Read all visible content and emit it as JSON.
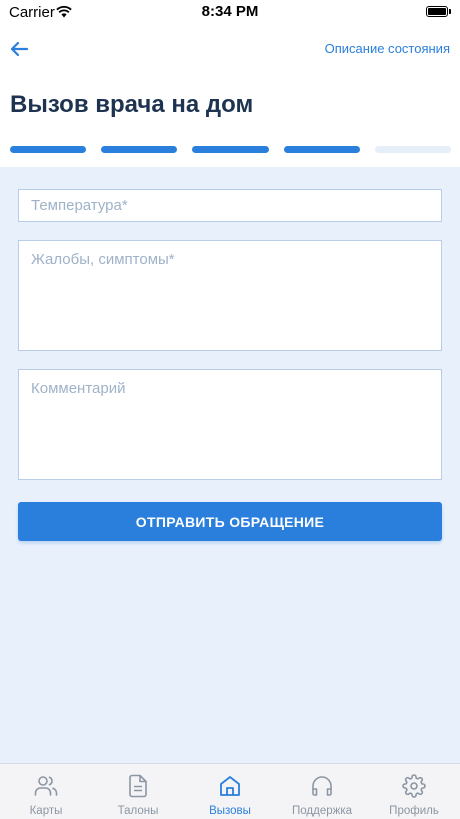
{
  "status_bar": {
    "carrier": "Carrier",
    "time": "8:34 PM"
  },
  "header": {
    "state_description_link": "Описание состояния",
    "title": "Вызов врача на дом",
    "steps": {
      "completed": 4,
      "total": 5
    }
  },
  "form": {
    "temperature_placeholder": "Температура*",
    "complaints_placeholder": "Жалобы, симптомы*",
    "comment_placeholder": "Комментарий",
    "submit_label": "ОТПРАВИТЬ ОБРАЩЕНИЕ"
  },
  "tabbar": {
    "items": [
      {
        "label": "Карты",
        "icon": "users-icon"
      },
      {
        "label": "Талоны",
        "icon": "document-icon"
      },
      {
        "label": "Вызовы",
        "icon": "home-icon",
        "active": true
      },
      {
        "label": "Поддержка",
        "icon": "headphones-icon"
      },
      {
        "label": "Профиль",
        "icon": "gear-icon"
      }
    ]
  },
  "colors": {
    "accent": "#2a7fdc",
    "title": "#1e3350",
    "background": "#e8f0fc",
    "inactive_step": "#e6eef9",
    "tab_inactive": "#8c96a3"
  }
}
